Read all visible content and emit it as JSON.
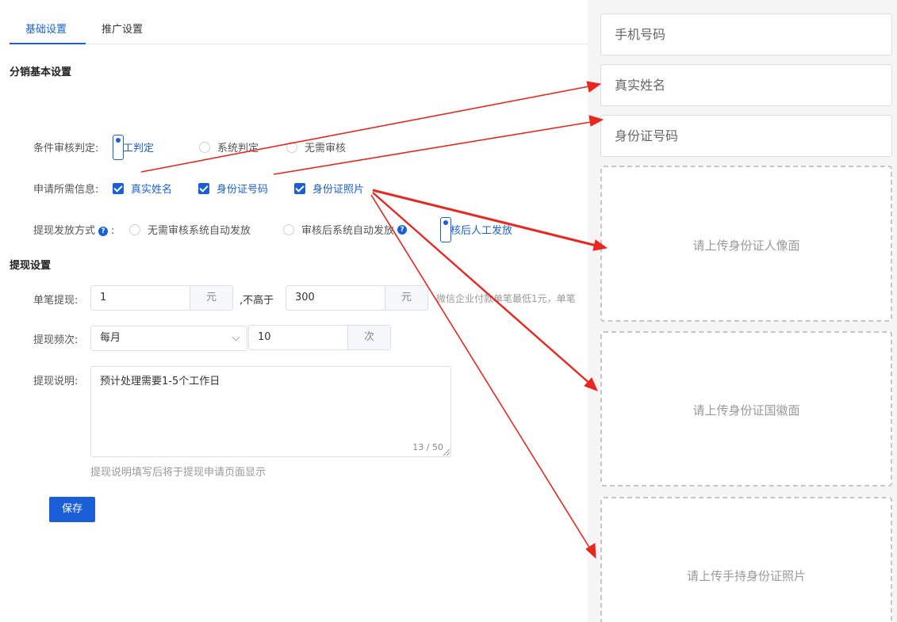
{
  "tabs": {
    "basic": "基础设置",
    "promo": "推广设置"
  },
  "section_distribution": "分销基本设置",
  "audit": {
    "label": "条件审核判定:",
    "options": [
      "人工判定",
      "系统判定",
      "无需审核"
    ],
    "selected": "人工判定"
  },
  "required_info": {
    "label": "申请所需信息:",
    "options": [
      "真实姓名",
      "身份证号码",
      "身份证照片"
    ],
    "checked": [
      "真实姓名",
      "身份证号码",
      "身份证照片"
    ]
  },
  "payout": {
    "label": "提现发放方式",
    "colon": ":",
    "options": [
      "无需审核系统自动发放",
      "审核后系统自动发放",
      "审核后人工发放"
    ],
    "selected": "审核后人工发放"
  },
  "section_withdraw": "提现设置",
  "single": {
    "label": "单笔提现:",
    "min_value": "1",
    "min_unit": "元",
    "sep": ",不高于",
    "max_value": "300",
    "max_unit": "元",
    "hint": "微信企业付款单笔最低1元，单笔"
  },
  "frequency": {
    "label": "提现频次:",
    "period": "每月",
    "count": "10",
    "unit": "次"
  },
  "note": {
    "label": "提现说明:",
    "value": "预计处理需要1-5个工作日",
    "counter": "13 / 50",
    "hint": "提现说明填写后将于提现申请页面显示"
  },
  "save_label": "保存",
  "preview": {
    "fields": [
      "手机号码",
      "真实姓名",
      "身份证号码"
    ],
    "uploads": [
      "请上传身份证人像面",
      "请上传身份证国徽面",
      "请上传手持身份证照片"
    ]
  },
  "colors": {
    "accent": "#1a5fd8",
    "arrow": "#e8271e"
  }
}
